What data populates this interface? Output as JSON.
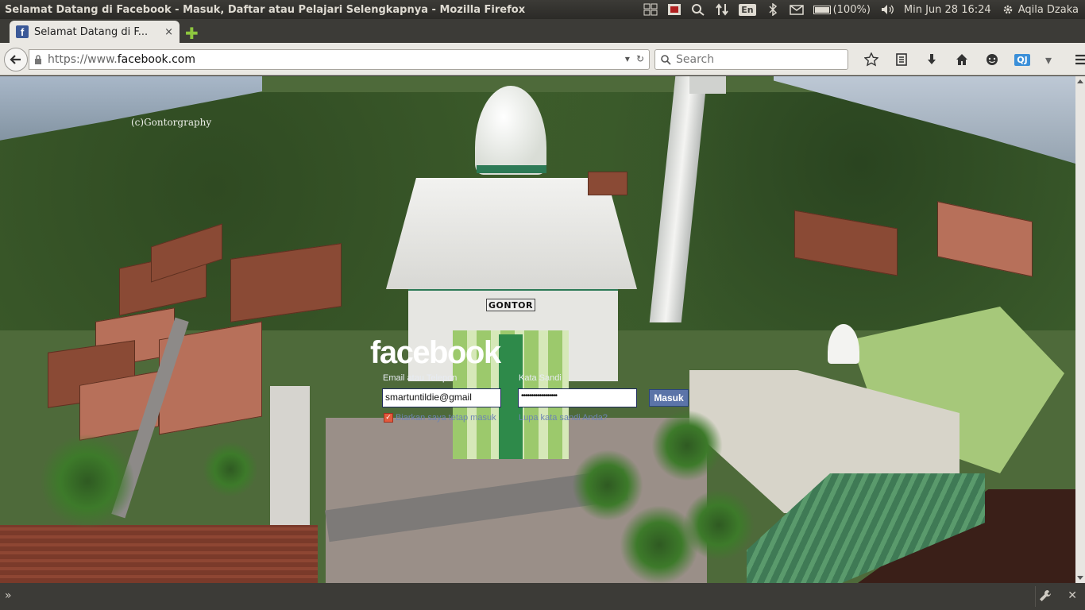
{
  "window": {
    "title": "Selamat Datang di Facebook - Masuk, Daftar atau Pelajari Selengkapnya - Mozilla Firefox"
  },
  "panel": {
    "keyboard_layout": "En",
    "battery": "(100%)",
    "datetime": "Min Jun 28 16:24",
    "user": "Aqila Dzaka",
    "icons": [
      "workspaces-icon",
      "record-icon",
      "search-icon",
      "network-transfer-icon",
      "keyboard-icon",
      "bluetooth-icon",
      "mail-icon",
      "battery-icon",
      "volume-icon",
      "gear-icon"
    ]
  },
  "tabs": [
    {
      "title": "Selamat Datang di F...",
      "close": "×"
    }
  ],
  "new_tab_glyph": "✚",
  "navbar": {
    "url_prefix": "https://www.",
    "url_host": "facebook.com",
    "search_placeholder": "Search",
    "qj_badge": "QJ"
  },
  "page": {
    "watermark": "(c)Gontorgraphy",
    "sign_text": "GONTOR",
    "fb_logo": "facebook",
    "email_label": "Email atau Telepon",
    "password_label": "Kata Sandi",
    "email_value": "smartuntildie@gmail",
    "password_value": "••••••••••••••••••",
    "login_button": "Masuk",
    "remember_label": "Biarkan saya tetap masuk",
    "forgot_link": "Lupa kata sandi Anda?"
  },
  "bottombar": {
    "left_glyph": "»",
    "right_icons": [
      "wrench-icon",
      "close-icon"
    ]
  },
  "colors": {
    "facebook_blue": "#3b5998",
    "ubuntu_panel": "#3c3b37",
    "browser_chrome": "#eae8e3"
  }
}
